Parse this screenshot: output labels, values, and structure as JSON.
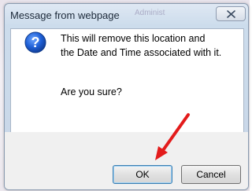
{
  "dialog": {
    "title": "Message from webpage",
    "background_title_ghost": "Administ",
    "message_line1": "This will remove this location and",
    "message_line2": "the Date and Time associated with it.",
    "question": "Are you sure?",
    "ok_label": "OK",
    "cancel_label": "Cancel",
    "icon": "question-icon",
    "close_icon": "close-icon"
  },
  "annotation": {
    "arrow_color": "#e31b1b",
    "points_to": "ok-button"
  }
}
